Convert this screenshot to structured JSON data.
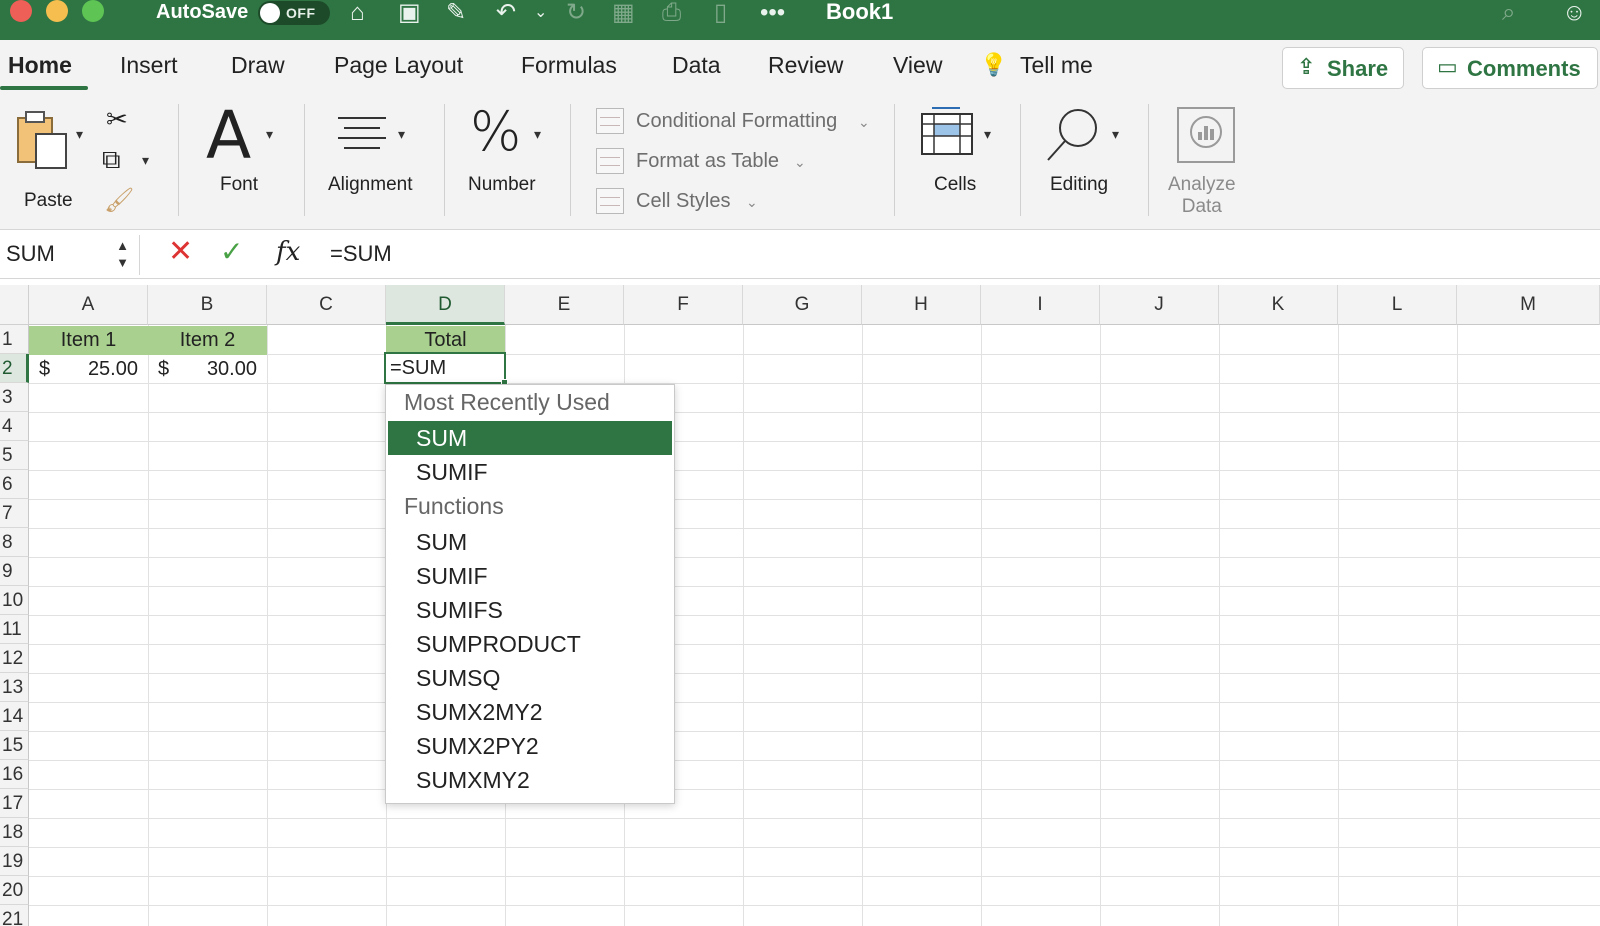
{
  "titlebar": {
    "autosave_label": "AutoSave",
    "autosave_state": "OFF",
    "book_title": "Book1"
  },
  "tabs": [
    "Home",
    "Insert",
    "Draw",
    "Page Layout",
    "Formulas",
    "Data",
    "Review",
    "View"
  ],
  "tell_me": "Tell me",
  "share_label": "Share",
  "comments_label": "Comments",
  "ribbon": {
    "paste": "Paste",
    "font": "Font",
    "alignment": "Alignment",
    "number": "Number",
    "conditional_formatting": "Conditional Formatting",
    "format_as_table": "Format as Table",
    "cell_styles": "Cell Styles",
    "cells": "Cells",
    "editing": "Editing",
    "analyze_data_line1": "Analyze",
    "analyze_data_line2": "Data"
  },
  "formula_bar": {
    "name_box": "SUM",
    "content": "=SUM"
  },
  "columns": [
    "A",
    "B",
    "C",
    "D",
    "E",
    "F",
    "G",
    "H",
    "I",
    "J",
    "K",
    "L",
    "M"
  ],
  "rows": [
    "1",
    "2",
    "3",
    "4",
    "5",
    "6",
    "7",
    "8",
    "9",
    "10",
    "11",
    "12",
    "13",
    "14",
    "15",
    "16",
    "17",
    "18",
    "19",
    "20",
    "21"
  ],
  "cells": {
    "a1": "Item 1",
    "b1": "Item 2",
    "d1": "Total",
    "a2_currency": "$",
    "a2_value": "25.00",
    "b2_currency": "$",
    "b2_value": "30.00",
    "d2": "=SUM"
  },
  "autocomplete": {
    "recent_header": "Most Recently Used",
    "recent": [
      "SUM",
      "SUMIF"
    ],
    "functions_header": "Functions",
    "functions": [
      "SUM",
      "SUMIF",
      "SUMIFS",
      "SUMPRODUCT",
      "SUMSQ",
      "SUMX2MY2",
      "SUMX2PY2",
      "SUMXMY2"
    ],
    "selected": "SUM"
  },
  "colors": {
    "accent": "#2f7543",
    "header_fill": "#a9d08e"
  }
}
